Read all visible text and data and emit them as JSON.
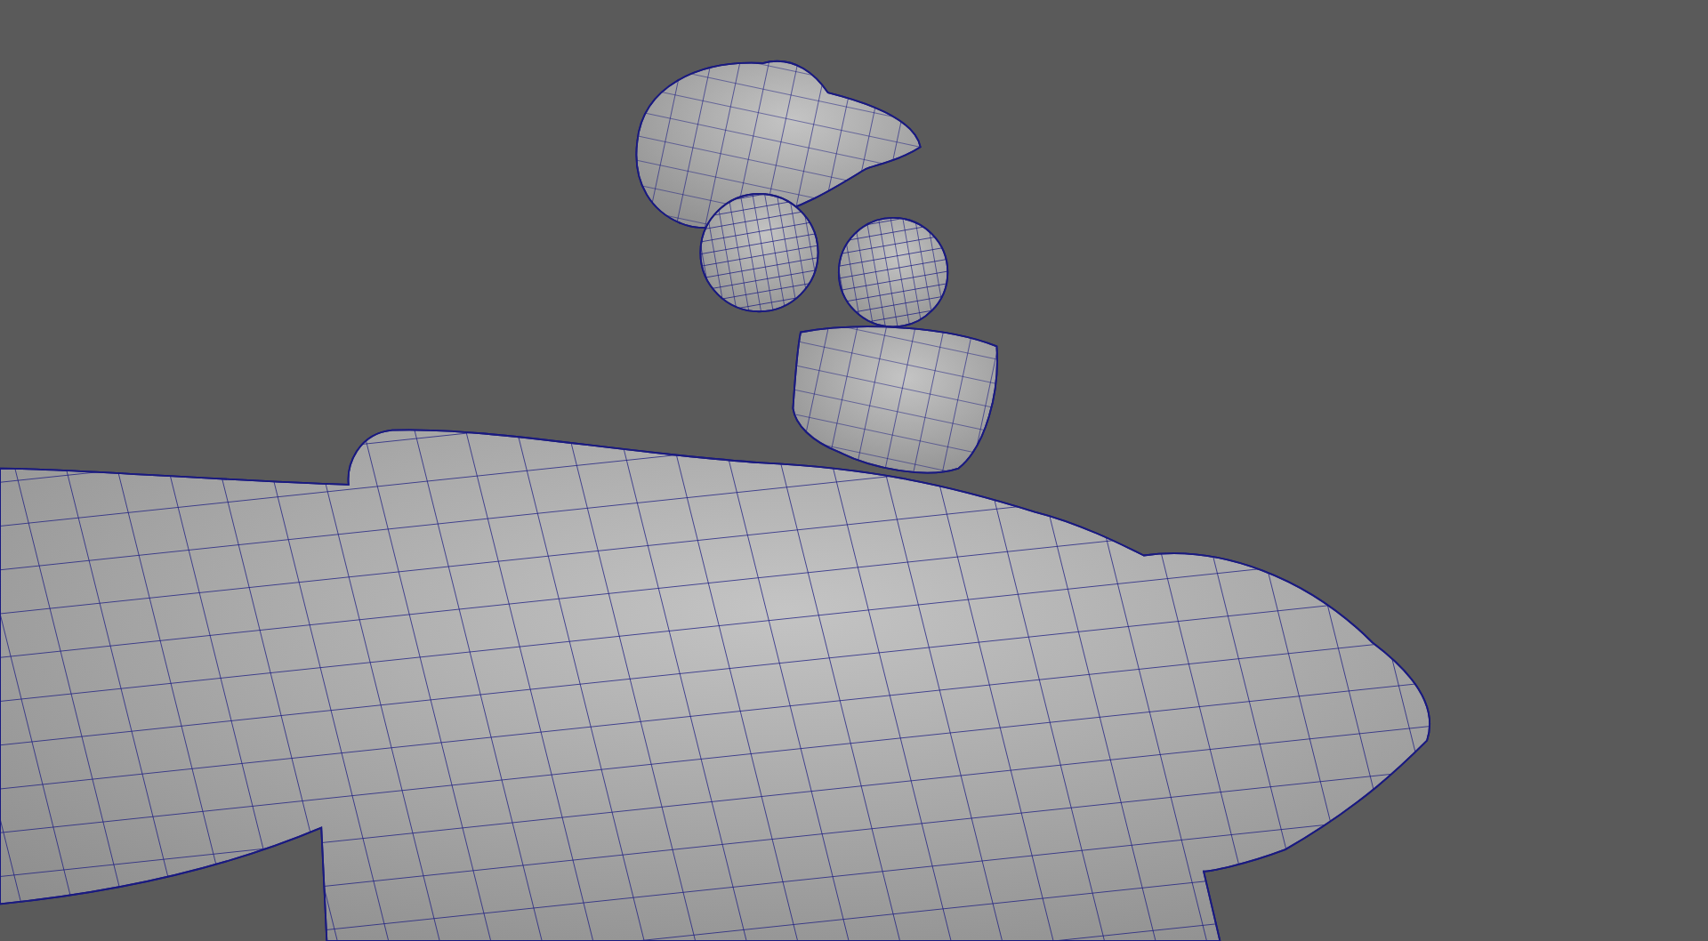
{
  "viewport": {
    "wireframe_on": true
  }
}
